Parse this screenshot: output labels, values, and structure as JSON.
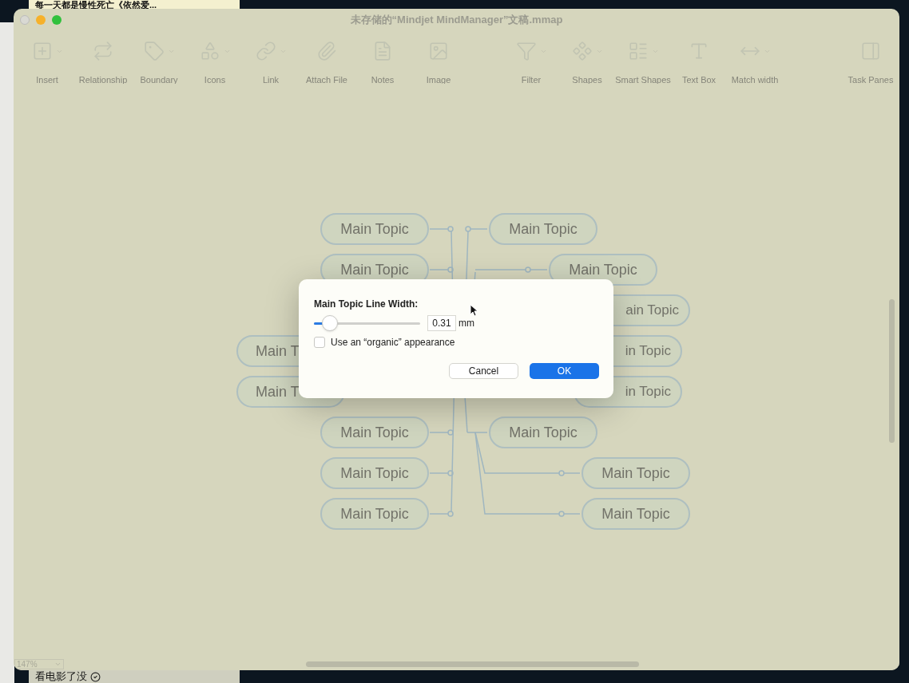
{
  "desktop": {
    "note_top": "每一天都是慢性死亡《依然爱...",
    "note_bottom": "看电影了没"
  },
  "window": {
    "title": "未存储的“Mindjet MindManager”文稿.mmap"
  },
  "toolbar": {
    "groups": [
      [
        {
          "label": "Insert",
          "menu": true
        },
        {
          "label": "Relationship",
          "menu": false
        },
        {
          "label": "Boundary",
          "menu": true
        },
        {
          "label": "Icons",
          "menu": true
        },
        {
          "label": "Link",
          "menu": true
        },
        {
          "label": "Attach File",
          "menu": false
        },
        {
          "label": "Notes",
          "menu": false
        },
        {
          "label": "Image",
          "menu": false
        }
      ],
      [
        {
          "label": "Filter",
          "menu": true
        },
        {
          "label": "Shapes",
          "menu": true
        },
        {
          "label": "Smart Shapes",
          "menu": true
        },
        {
          "label": "Text Box",
          "menu": false
        },
        {
          "label": "Match width",
          "menu": true
        }
      ],
      [
        {
          "label": "Task Panes",
          "menu": false
        }
      ]
    ]
  },
  "map": {
    "left_topics": [
      {
        "label": "Main Topic",
        "kind": "full"
      },
      {
        "label": "Main Topic",
        "kind": "full"
      },
      {
        "label": "Main T",
        "kind": "cut_right"
      },
      {
        "label": "Main T",
        "kind": "cut_right"
      },
      {
        "label": "Main Topic",
        "kind": "full"
      },
      {
        "label": "Main Topic",
        "kind": "full"
      },
      {
        "label": "Main Topic",
        "kind": "full"
      }
    ],
    "right_topics": [
      {
        "label": "Main Topic",
        "kind": "full"
      },
      {
        "label": "Main Topic",
        "kind": "full"
      },
      {
        "label": "ain Topic",
        "kind": "cut_left"
      },
      {
        "label": "in Topic",
        "kind": "cut_left"
      },
      {
        "label": "in Topic",
        "kind": "cut_left"
      },
      {
        "label": "Main Topic",
        "kind": "full"
      },
      {
        "label": "Main Topic",
        "kind": "full"
      },
      {
        "label": "Main Topic",
        "kind": "full"
      }
    ]
  },
  "zoom": {
    "value": "147%"
  },
  "dialog": {
    "title": "Main Topic Line Width:",
    "slider": {
      "level": 0.09
    },
    "value": "0.31",
    "unit": "mm",
    "checkbox": {
      "label": "Use an “organic” appearance",
      "checked": false
    },
    "buttons": [
      {
        "label": "Cancel",
        "default": false
      },
      {
        "label": "OK",
        "default": true
      }
    ]
  }
}
